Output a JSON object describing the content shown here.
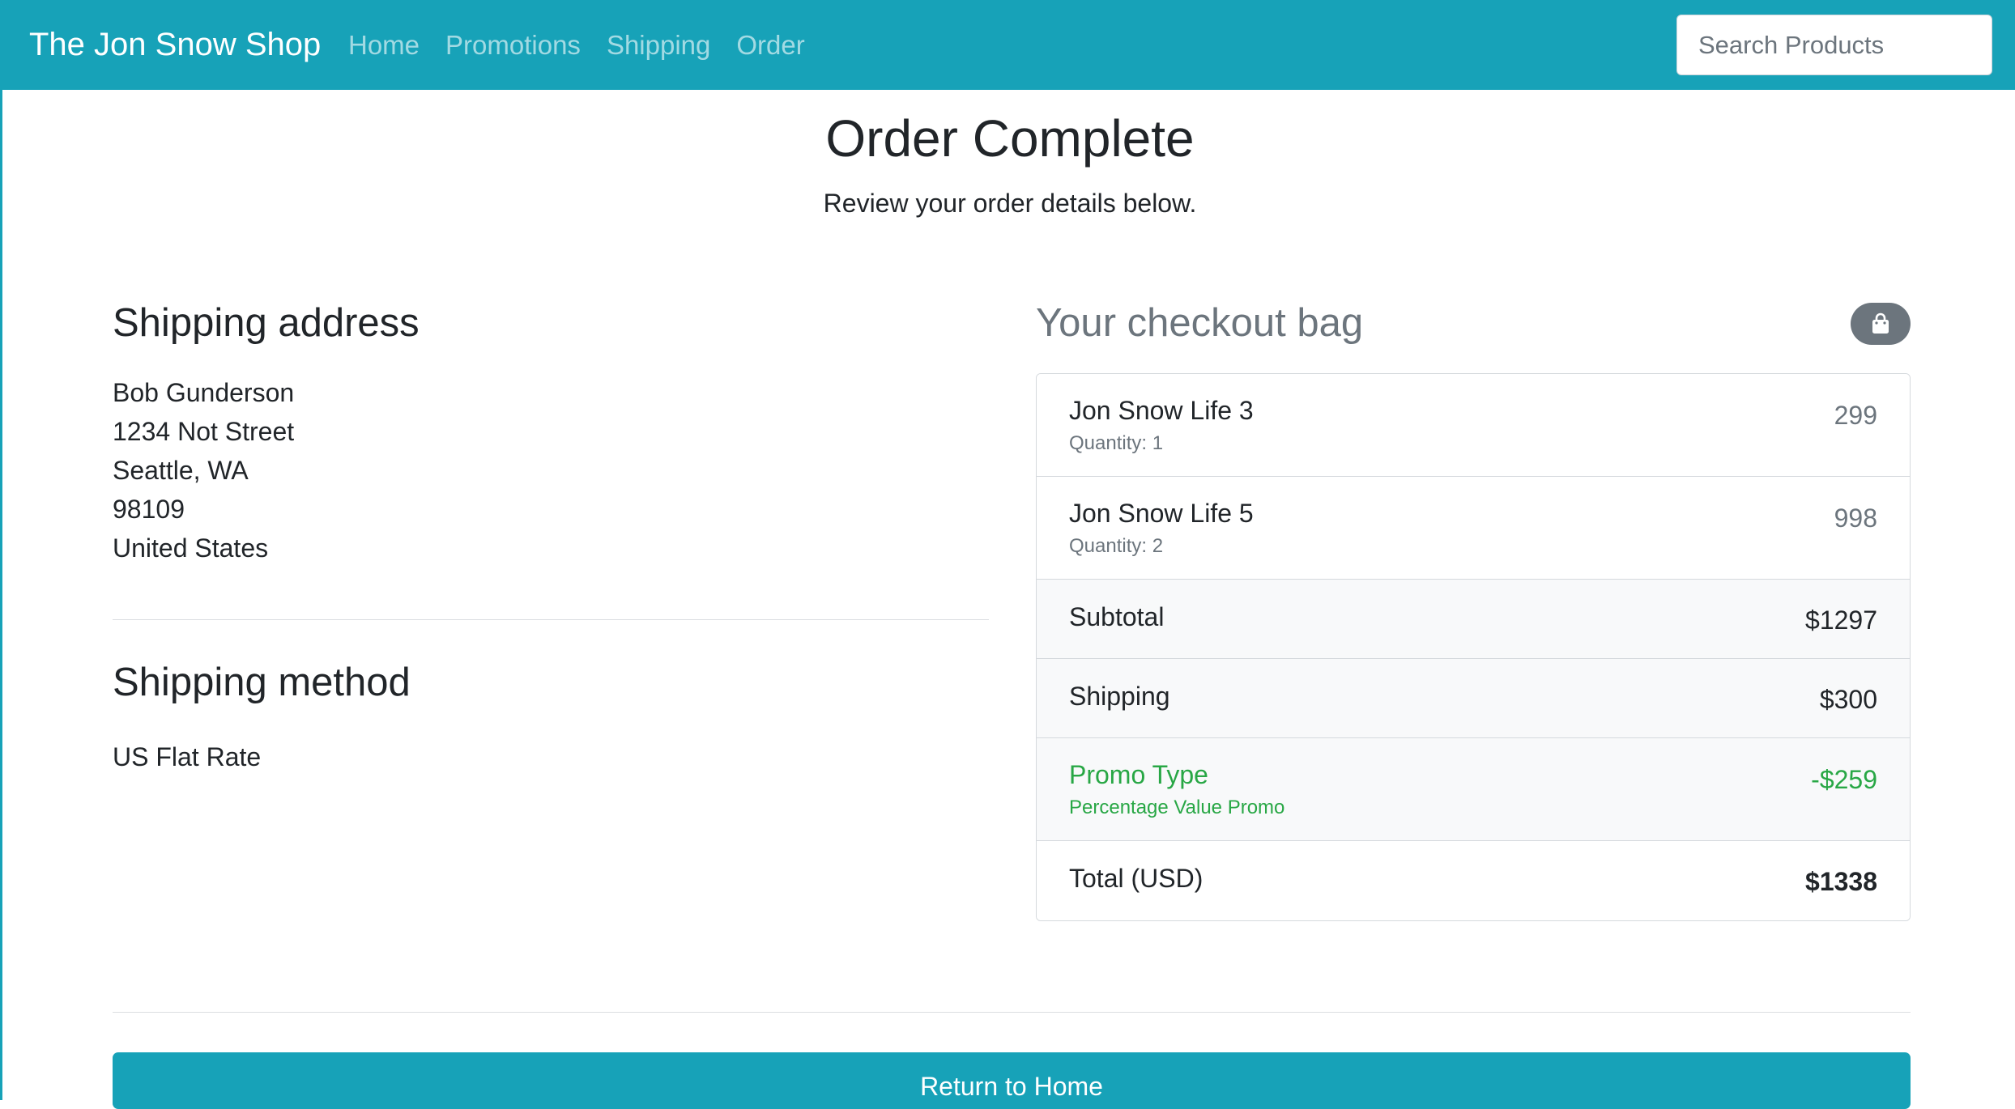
{
  "navbar": {
    "brand": "The Jon Snow Shop",
    "links": [
      "Home",
      "Promotions",
      "Shipping",
      "Order"
    ],
    "search_placeholder": "Search Products"
  },
  "header": {
    "title": "Order Complete",
    "lead": "Review your order details below."
  },
  "shipping_address": {
    "heading": "Shipping address",
    "lines": [
      "Bob Gunderson",
      "1234 Not Street",
      "Seattle, WA",
      "98109",
      "United States"
    ]
  },
  "shipping_method": {
    "heading": "Shipping method",
    "value": "US Flat Rate"
  },
  "checkout_bag": {
    "title": "Your checkout bag",
    "badge_icon": "shopping-bag-icon",
    "items": [
      {
        "name": "Jon Snow Life 3",
        "quantity": "Quantity: 1",
        "price": "299"
      },
      {
        "name": "Jon Snow Life 5",
        "quantity": "Quantity: 2",
        "price": "998"
      }
    ],
    "subtotal": {
      "label": "Subtotal",
      "value": "$1297"
    },
    "shipping": {
      "label": "Shipping",
      "value": "$300"
    },
    "promo": {
      "label": "Promo Type",
      "detail": "Percentage Value Promo",
      "value": "-$259"
    },
    "total": {
      "label": "Total (USD)",
      "value": "$1338"
    }
  },
  "actions": {
    "return_label": "Return to Home"
  },
  "colors": {
    "primary": "#17a2b8",
    "success": "#28a745",
    "muted": "#6c757d",
    "light": "#f8f9fa"
  }
}
